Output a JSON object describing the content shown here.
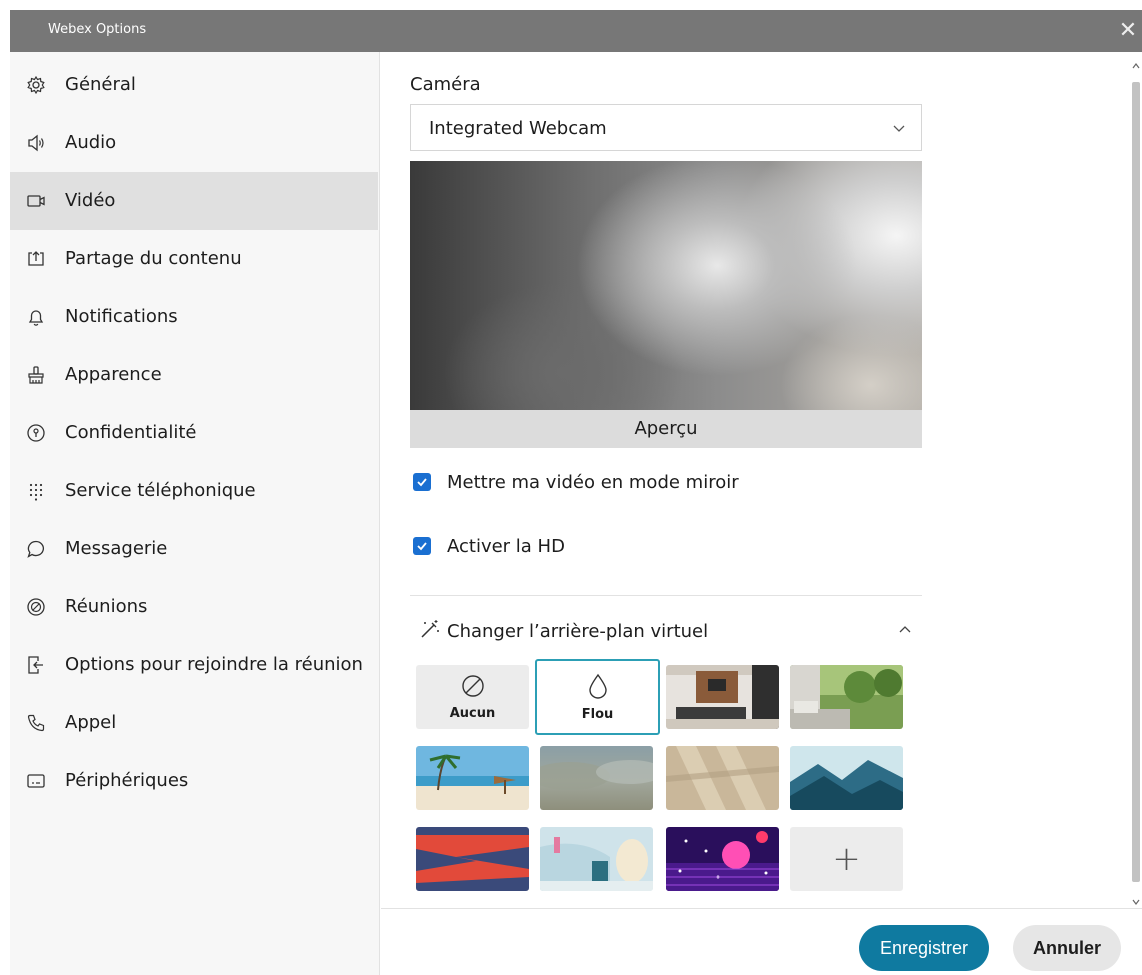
{
  "window": {
    "title": "Webex Options",
    "close_glyph": "✕"
  },
  "sidebar": {
    "items": [
      {
        "label": "Général",
        "icon": "gear-icon"
      },
      {
        "label": "Audio",
        "icon": "speaker-icon"
      },
      {
        "label": "Vidéo",
        "icon": "video-camera-icon",
        "active": true
      },
      {
        "label": "Partage du contenu",
        "icon": "share-upload-icon"
      },
      {
        "label": "Notifications",
        "icon": "bell-icon"
      },
      {
        "label": "Apparence",
        "icon": "paint-icon"
      },
      {
        "label": "Confidentialité",
        "icon": "privacy-icon"
      },
      {
        "label": "Service téléphonique",
        "icon": "dialpad-icon"
      },
      {
        "label": "Messagerie",
        "icon": "chat-bubble-icon"
      },
      {
        "label": "Réunions",
        "icon": "meetings-icon"
      },
      {
        "label": "Options pour rejoindre la réunion",
        "icon": "join-icon"
      },
      {
        "label": "Appel",
        "icon": "phone-icon"
      },
      {
        "label": "Périphériques",
        "icon": "devices-icon"
      }
    ]
  },
  "video": {
    "camera_label": "Caméra",
    "camera_selected": "Integrated Webcam",
    "preview_caption": "Aperçu",
    "mirror_label": "Mettre ma vidéo en mode miroir",
    "mirror_checked": true,
    "hd_label": "Activer la HD",
    "hd_checked": true
  },
  "background": {
    "header": "Changer l’arrière-plan virtuel",
    "none_label": "Aucun",
    "blur_label": "Flou",
    "selected": "Flou",
    "add_glyph": "+"
  },
  "footer": {
    "save": "Enregistrer",
    "cancel": "Annuler"
  },
  "colors": {
    "accent": "#0f7aa0",
    "checkbox": "#1a6fd1",
    "selected_border": "#2c9fb5",
    "titlebar": "#777777"
  }
}
